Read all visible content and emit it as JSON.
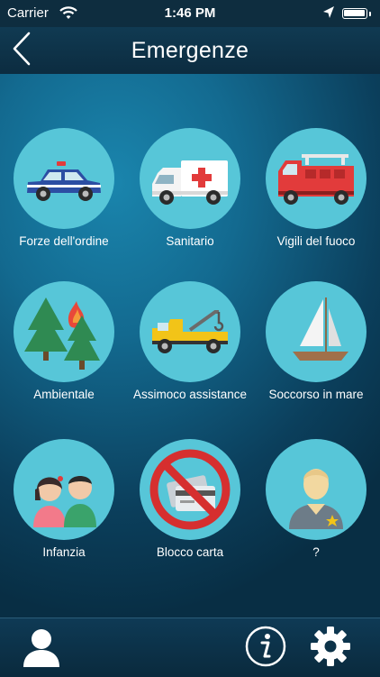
{
  "status_bar": {
    "carrier": "Carrier",
    "time": "1:46 PM",
    "wifi_icon": "wifi-icon",
    "location_icon": "location-arrow-icon",
    "battery_icon": "battery-icon"
  },
  "nav": {
    "title": "Emergenze",
    "back_icon": "chevron-left-icon"
  },
  "colors": {
    "circle": "#57c6d8",
    "background_top": "#1a85ad",
    "background_bottom": "#082e44",
    "nav_bar": "#0e2d3f"
  },
  "categories": [
    {
      "label": "Forze dell'ordine",
      "icon": "police-car-icon"
    },
    {
      "label": "Sanitario",
      "icon": "ambulance-icon"
    },
    {
      "label": "Vigili del fuoco",
      "icon": "fire-truck-icon"
    },
    {
      "label": "Ambientale",
      "icon": "forest-fire-icon"
    },
    {
      "label": "Assimoco assistance",
      "icon": "tow-truck-icon"
    },
    {
      "label": "Soccorso in mare",
      "icon": "sailboat-icon"
    },
    {
      "label": "Infanzia",
      "icon": "children-icon"
    },
    {
      "label": "Blocco carta",
      "icon": "card-block-icon"
    },
    {
      "label": "?",
      "icon": "officer-icon"
    }
  ],
  "tab_bar": {
    "profile_icon": "user-icon",
    "info_icon": "info-icon",
    "settings_icon": "gear-icon"
  }
}
